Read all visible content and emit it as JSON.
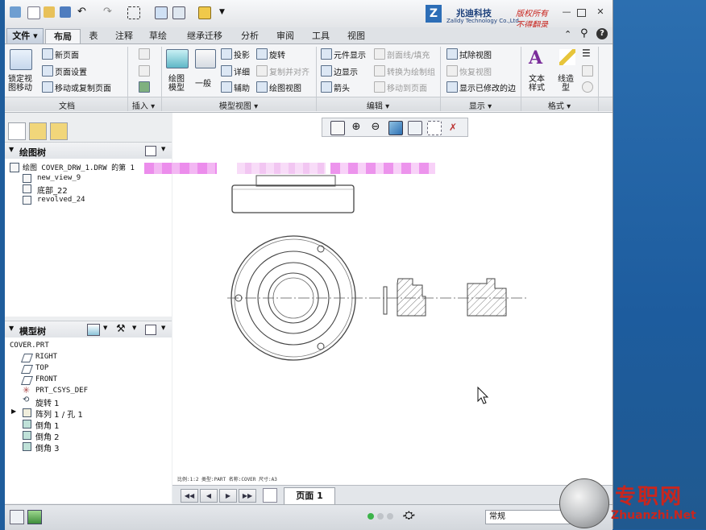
{
  "brand": {
    "logo_letter": "Z",
    "name_cn": "兆迪科技",
    "name_en": "Zalldy Technology Co.,Ltd.",
    "slogan_line1": "版权所有",
    "slogan_line2": "不得翻录"
  },
  "tabs": [
    "文件",
    "布局",
    "表",
    "注释",
    "草绘",
    "继承迁移",
    "分析",
    "审阅",
    "工具",
    "视图"
  ],
  "active_tab": "布局",
  "ribbon": {
    "doc": {
      "lock_view_move": "锁定视图移动",
      "new_page": "新页面",
      "page_setup": "页面设置",
      "move_copy_page": "移动或复制页面"
    },
    "model_view": {
      "drawing_model": "绘图模型",
      "general": "一般",
      "projection": "投影",
      "detail": "详细",
      "auxiliary": "辅助",
      "revolve": "旋转",
      "copy_align": "复制并对齐",
      "drawing_view": "绘图视图"
    },
    "edit": {
      "element_display": "元件显示",
      "edge_display": "边显示",
      "arrow": "箭头",
      "section_fill": "剖面线/填充",
      "convert_drawing": "转换为绘制组",
      "move_to_page": "移动到页面"
    },
    "display": {
      "erase_view": "拭除视图",
      "restore_view": "恢复视图",
      "show_modified_edges": "显示已修改的边"
    },
    "format": {
      "text_style": "文本样式",
      "line_type": "线造型"
    }
  },
  "groups": [
    "文档",
    "插入 ▾",
    "模型视图 ▾",
    "编辑 ▾",
    "显示 ▾",
    "格式 ▾"
  ],
  "drawing_tree": {
    "title": "绘图树",
    "root": "绘图 COVER_DRW_1.DRW 的第 1",
    "items": [
      "new_view_9",
      "底部_22",
      "revolved_24"
    ]
  },
  "model_tree": {
    "title": "模型树",
    "root": "COVER.PRT",
    "items": [
      "RIGHT",
      "TOP",
      "FRONT",
      "PRT_CSYS_DEF",
      "旋转 1",
      "阵列 1 / 孔 1",
      "倒角 1",
      "倒角 2",
      "倒角 3"
    ]
  },
  "canvas_status": "比例:1:2    类型:PART  名称:COVER  尺寸:A3",
  "page_tab": "页面 1",
  "style_box": "常规",
  "watermark": {
    "cn": "专职网",
    "url": "Zhuanzhi.Net"
  },
  "colors": {
    "ribbon_bg": "#f4f5f7",
    "desktop": "#1f5d9c",
    "watermark_red": "#c8261e",
    "blur_pink": "#e879e8"
  }
}
